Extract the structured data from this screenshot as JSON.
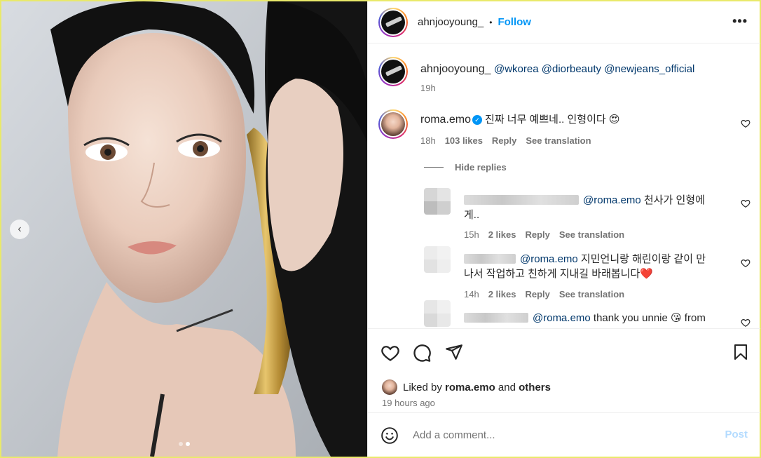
{
  "post": {
    "username": "ahnjooyoung_",
    "follow_label": "Follow",
    "separator": "•",
    "more_label": "•••"
  },
  "caption": {
    "username": "ahnjooyoung_",
    "mentions": "@wkorea @diorbeauty @newjeans_official",
    "time": "19h"
  },
  "comments": [
    {
      "username": "roma.emo",
      "text": "진짜 너무 예쁘네.. 인형이다 😍",
      "time": "18h",
      "likes": "103 likes",
      "reply_label": "Reply",
      "translate_label": "See translation"
    }
  ],
  "hide_replies_label": "Hide replies",
  "replies": [
    {
      "username_visible": "",
      "mention": "@roma.emo",
      "text_line1": "천사가 인형에",
      "text_line2": "게..",
      "time": "15h",
      "likes": "2 likes",
      "reply_label": "Reply",
      "translate_label": "See translation"
    },
    {
      "username_visible": "",
      "mention": "@roma.emo",
      "text_line1": "지민언니랑 해린이랑 같이 만",
      "text_line2": "나서 작업하고 친하게 지내길 바래봅니다❤️",
      "time": "14h",
      "likes": "2 likes",
      "reply_label": "Reply",
      "translate_label": "See translation"
    },
    {
      "username_visible": "",
      "mention": "@roma.emo",
      "text_line1": "thank you unnie 😘 from",
      "text_line2": ""
    }
  ],
  "liked_by": {
    "prefix": "Liked by",
    "user": "roma.emo",
    "joiner": "and",
    "others": "others"
  },
  "posted_ago": "19 hours ago",
  "add_comment": {
    "placeholder": "Add a comment...",
    "post_label": "Post"
  },
  "colors": {
    "link_blue": "#0095f6",
    "mention_blue": "#00376b",
    "muted": "#737373",
    "post_disabled": "#b3dbff"
  }
}
